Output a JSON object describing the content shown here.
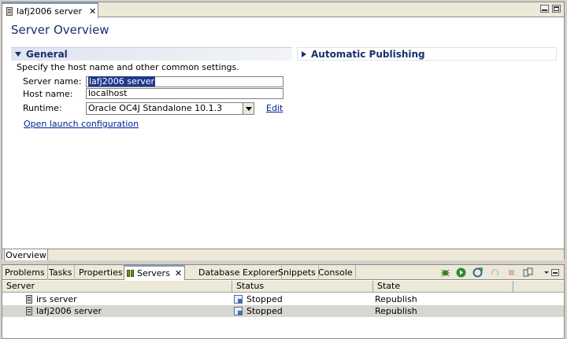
{
  "editor": {
    "tab_title": "lafj2006 server",
    "page_title": "Server Overview",
    "general": {
      "heading": "General",
      "description": "Specify the host name and other common settings.",
      "server_name_label": "Server name:",
      "server_name_value": "lafj2006 server",
      "host_name_label": "Host name:",
      "host_name_value": "localhost",
      "runtime_label": "Runtime:",
      "runtime_value": "Oracle OC4J Standalone 10.1.3",
      "edit_link": "Edit",
      "launch_link": "Open launch configuration"
    },
    "auto_publishing": {
      "heading": "Automatic Publishing"
    },
    "bottom_tab": "Overview"
  },
  "panel": {
    "tabs": [
      "Problems",
      "Tasks",
      "Properties",
      "Servers",
      "Database Explorer",
      "Snippets",
      "Console"
    ],
    "columns": [
      "Server",
      "Status",
      "State"
    ],
    "rows": [
      {
        "server": "irs server",
        "status": "Stopped",
        "state": "Republish"
      },
      {
        "server": "lafj2006 server",
        "status": "Stopped",
        "state": "Republish"
      }
    ]
  },
  "colors": {
    "title": "#1a2f6e",
    "link": "#001e96",
    "selection": "#1e3a8a"
  }
}
